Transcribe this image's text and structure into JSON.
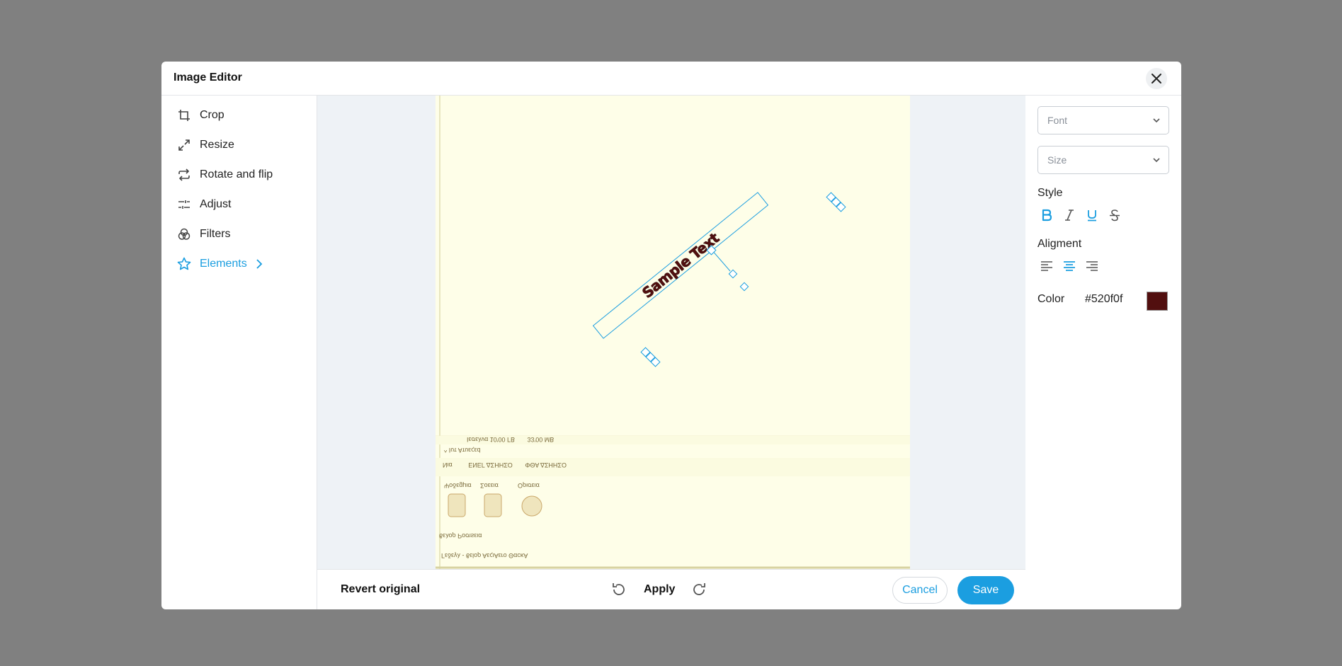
{
  "dialog": {
    "title": "Image Editor"
  },
  "tools": [
    {
      "label": "Crop",
      "icon": "crop-icon"
    },
    {
      "label": "Resize",
      "icon": "resize-icon"
    },
    {
      "label": "Rotate and flip",
      "icon": "rotate-flip-icon"
    },
    {
      "label": "Adjust",
      "icon": "sliders-icon"
    },
    {
      "label": "Filters",
      "icon": "filters-icon"
    },
    {
      "label": "Elements",
      "icon": "star-icon",
      "active": true
    }
  ],
  "canvas": {
    "text_element": "Sample Text",
    "photo_texts": {
      "row1": "Ιεσελνα 10'00 ΓΒ       33'00 ΜΒ",
      "row2": "^ Ιυτ Ατυεςεd",
      "row3": "Νια         ΕΝΕΓ ΔΣΗΗΣΟ       ΦΘΑ ΔΣΗΗΣΟ",
      "labels": [
        "Ψοδεgμια",
        "Σοεεια",
        "Ορισεια"
      ],
      "row4": "ϐελορ Ροσιsεια",
      "row5": "Γεδεγλ - ϐεlορ ΑεςιΑεrο ΘαcκΑ"
    }
  },
  "bottom_bar": {
    "revert_label": "Revert original",
    "apply_label": "Apply",
    "cancel_label": "Cancel",
    "save_label": "Save"
  },
  "text_panel": {
    "font_placeholder": "Font",
    "size_placeholder": "Size",
    "style_label": "Style",
    "style_buttons": [
      "bold",
      "italic",
      "underline",
      "strikethrough"
    ],
    "active_styles": [
      "bold",
      "underline"
    ],
    "alignment_label": "Aligment",
    "alignment_options": [
      "left",
      "center",
      "right"
    ],
    "alignment_selected": "center",
    "color_label": "Color",
    "color_value": "#520f0f"
  },
  "colors": {
    "accent": "#1b9ee0",
    "text_color": "#520f0f",
    "overlay": "#808080"
  }
}
